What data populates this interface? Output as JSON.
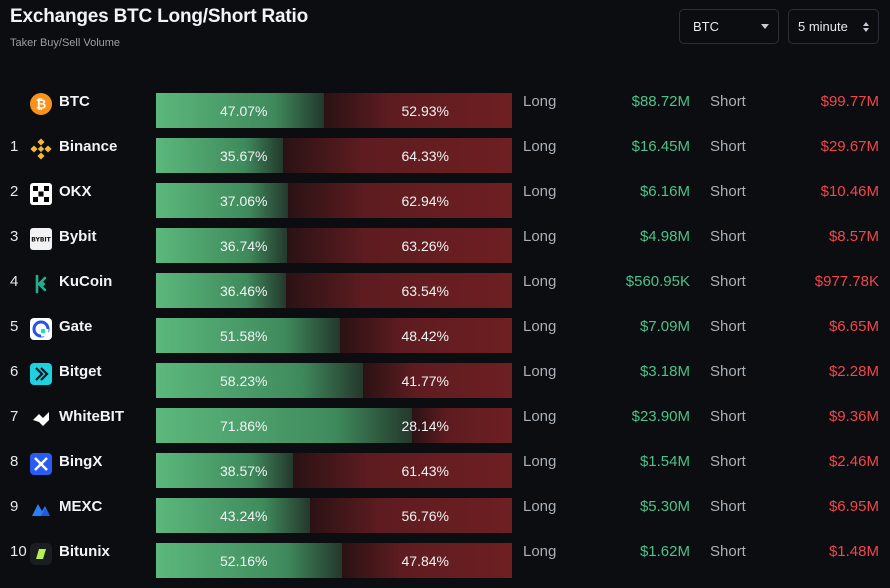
{
  "header": {
    "title": "Exchanges BTC Long/Short Ratio",
    "subtitle": "Taker Buy/Sell Volume"
  },
  "controls": {
    "symbol": "BTC",
    "interval": "5 minute"
  },
  "labels": {
    "long": "Long",
    "short": "Short"
  },
  "colors": {
    "long": "#4cc38a",
    "short": "#f0474d",
    "background": "#0b0d10"
  },
  "rows": [
    {
      "rank": "",
      "name": "BTC",
      "icon": "btc-icon",
      "long_pct": "47.07%",
      "short_pct": "52.93%",
      "long_val": "$88.72M",
      "short_val": "$99.77M",
      "long_ratio": 0.4707
    },
    {
      "rank": "1",
      "name": "Binance",
      "icon": "binance-icon",
      "long_pct": "35.67%",
      "short_pct": "64.33%",
      "long_val": "$16.45M",
      "short_val": "$29.67M",
      "long_ratio": 0.3567
    },
    {
      "rank": "2",
      "name": "OKX",
      "icon": "okx-icon",
      "long_pct": "37.06%",
      "short_pct": "62.94%",
      "long_val": "$6.16M",
      "short_val": "$10.46M",
      "long_ratio": 0.3706
    },
    {
      "rank": "3",
      "name": "Bybit",
      "icon": "bybit-icon",
      "long_pct": "36.74%",
      "short_pct": "63.26%",
      "long_val": "$4.98M",
      "short_val": "$8.57M",
      "long_ratio": 0.3674
    },
    {
      "rank": "4",
      "name": "KuCoin",
      "icon": "kucoin-icon",
      "long_pct": "36.46%",
      "short_pct": "63.54%",
      "long_val": "$560.95K",
      "short_val": "$977.78K",
      "long_ratio": 0.3646
    },
    {
      "rank": "5",
      "name": "Gate",
      "icon": "gate-icon",
      "long_pct": "51.58%",
      "short_pct": "48.42%",
      "long_val": "$7.09M",
      "short_val": "$6.65M",
      "long_ratio": 0.5158
    },
    {
      "rank": "6",
      "name": "Bitget",
      "icon": "bitget-icon",
      "long_pct": "58.23%",
      "short_pct": "41.77%",
      "long_val": "$3.18M",
      "short_val": "$2.28M",
      "long_ratio": 0.5823
    },
    {
      "rank": "7",
      "name": "WhiteBIT",
      "icon": "whitebit-icon",
      "long_pct": "71.86%",
      "short_pct": "28.14%",
      "long_val": "$23.90M",
      "short_val": "$9.36M",
      "long_ratio": 0.7186
    },
    {
      "rank": "8",
      "name": "BingX",
      "icon": "bingx-icon",
      "long_pct": "38.57%",
      "short_pct": "61.43%",
      "long_val": "$1.54M",
      "short_val": "$2.46M",
      "long_ratio": 0.3857
    },
    {
      "rank": "9",
      "name": "MEXC",
      "icon": "mexc-icon",
      "long_pct": "43.24%",
      "short_pct": "56.76%",
      "long_val": "$5.30M",
      "short_val": "$6.95M",
      "long_ratio": 0.4324
    },
    {
      "rank": "10",
      "name": "Bitunix",
      "icon": "bitunix-icon",
      "long_pct": "52.16%",
      "short_pct": "47.84%",
      "long_val": "$1.62M",
      "short_val": "$1.48M",
      "long_ratio": 0.5216
    }
  ]
}
